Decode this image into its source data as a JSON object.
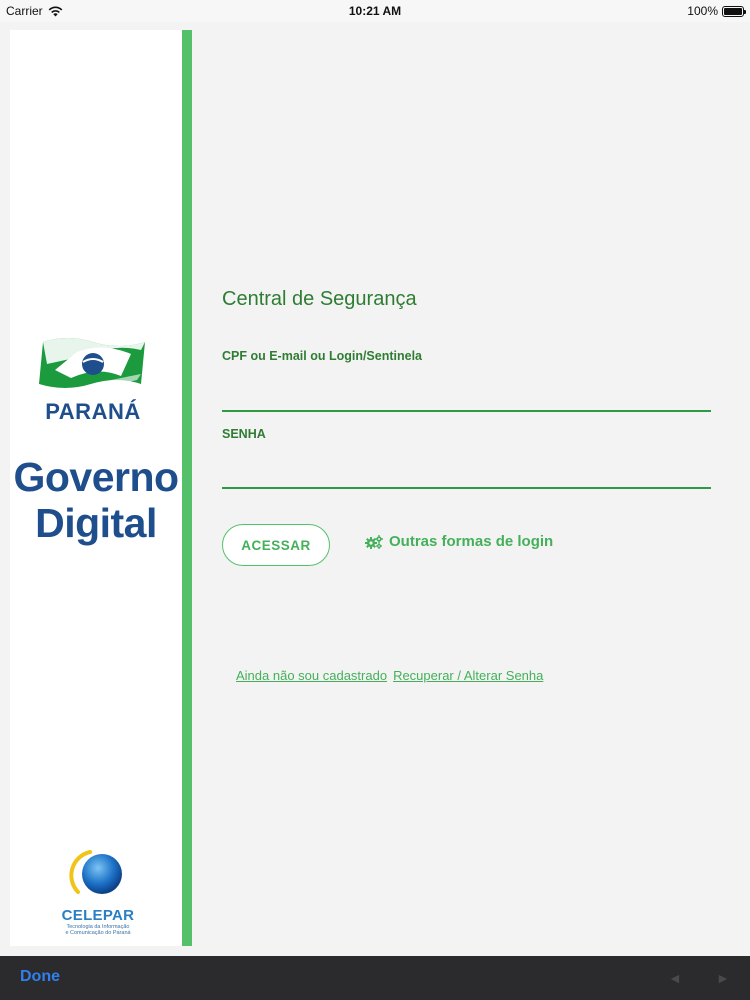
{
  "status_bar": {
    "carrier": "Carrier",
    "time": "10:21 AM",
    "battery": "100%",
    "battery_level": 1.0
  },
  "branding": {
    "state_name": "PARANÁ",
    "title_line1": "Governo",
    "title_line2": "Digital",
    "company": "CELEPAR",
    "company_subtitle_line1": "Tecnologia da Informação",
    "company_subtitle_line2": "e Comunicação do Paraná"
  },
  "form": {
    "title": "Central de Segurança",
    "username_label": "CPF ou E-mail ou Login/Sentinela",
    "username_value": "",
    "password_label": "SENHA",
    "password_value": "",
    "submit_label": "ACESSAR",
    "other_login_label": "Outras formas de login"
  },
  "links": {
    "register": "Ainda não sou cadastrado",
    "recover": "Recuperar / Alterar Senha"
  },
  "toolbar": {
    "done_label": "Done",
    "back_glyph": "◄",
    "forward_glyph": "►"
  },
  "colors": {
    "accent_green": "#55c06a",
    "text_green": "#2e7d32",
    "brand_blue": "#1f4e8c",
    "toolbar_bg": "#2b2b2d",
    "done_blue": "#2f80ed"
  },
  "icons": {
    "wifi": "wifi-icon",
    "gears": "gears-icon",
    "flag": "parana-flag-icon",
    "celepar": "celepar-logo-icon"
  }
}
